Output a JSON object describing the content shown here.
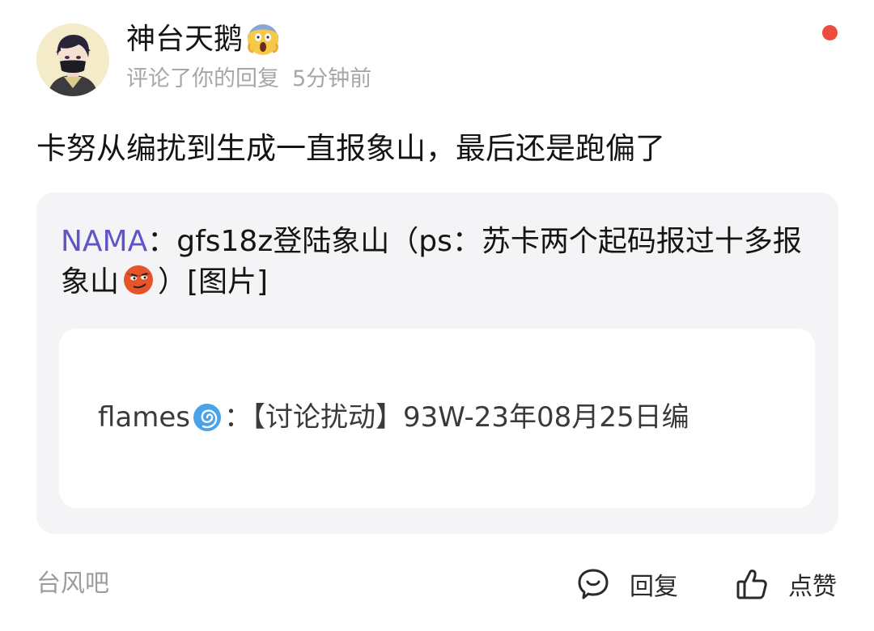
{
  "header": {
    "user_name": "神台天鹅",
    "action_text": "评论了你的回复",
    "time_ago": "5分钟前",
    "name_emoji": "face-screaming-icon",
    "unread_dot_color": "#ee4b3e"
  },
  "comment": {
    "text": "卡努从编扰到生成一直报象山，最后还是跑偏了"
  },
  "quote": {
    "author": "NAMA",
    "text_part1": "：gfs18z登陆象山（ps：苏卡两个起码报过十多报象山",
    "emoji": "smirk-ball-emoji-icon",
    "text_part2": "）[图片]",
    "author_color": "#5f55c6"
  },
  "inner_quote": {
    "author": "flames",
    "emoji": "cyclone-icon",
    "text": "：【讨论扰动】93W-23年08月25日编"
  },
  "footer": {
    "forum_name": "台风吧",
    "reply_label": "回复",
    "like_label": "点赞",
    "reply_icon": "comment-bubble-icon",
    "like_icon": "thumbs-up-icon"
  }
}
